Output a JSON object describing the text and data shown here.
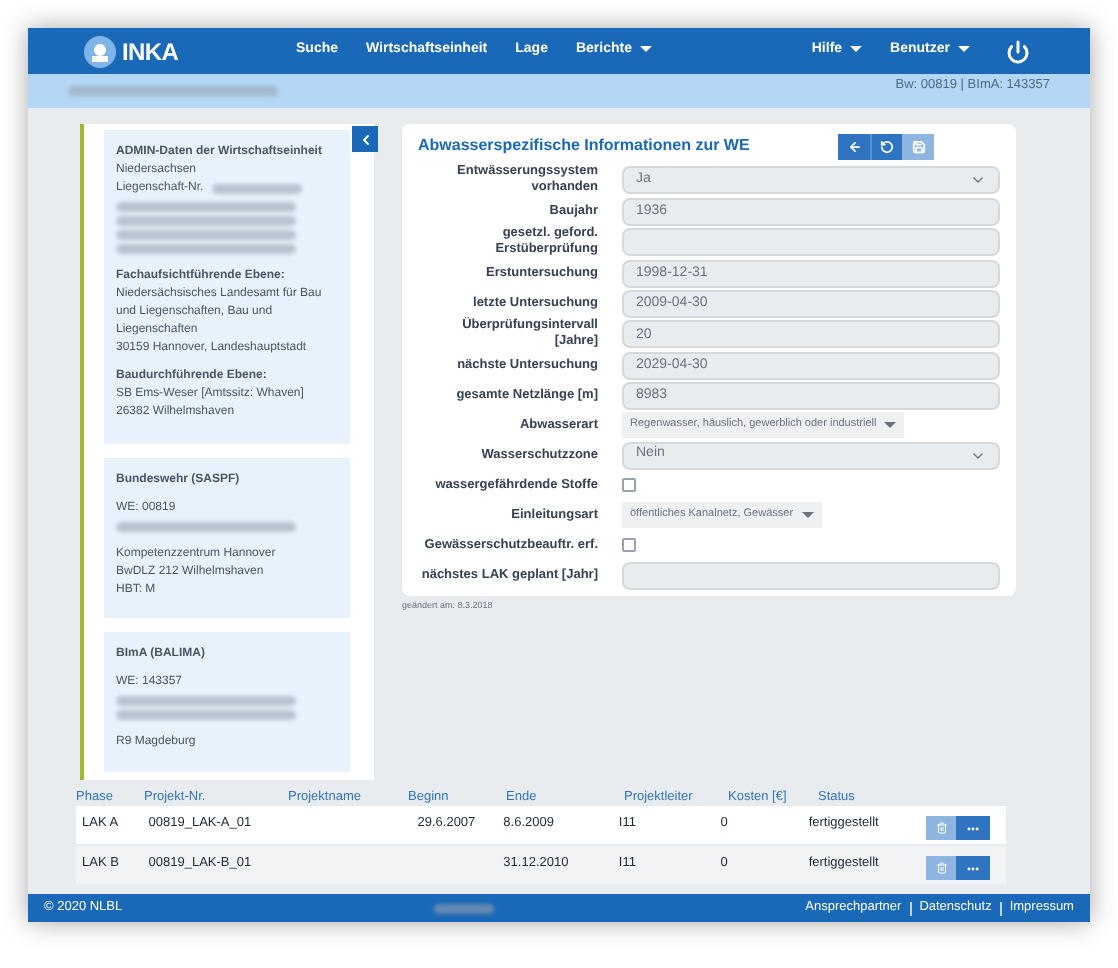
{
  "nav": {
    "brand": "INKA",
    "menu": [
      {
        "label": "Suche",
        "dropdown": false
      },
      {
        "label": "Wirtschaftseinheit",
        "dropdown": false
      },
      {
        "label": "Lage",
        "dropdown": false
      },
      {
        "label": "Berichte",
        "dropdown": true
      }
    ],
    "right_menu": [
      {
        "label": "Hilfe",
        "dropdown": true
      },
      {
        "label": "Benutzer",
        "dropdown": true
      }
    ]
  },
  "subbar": {
    "ids": "Bw: 00819 | BImA: 143357"
  },
  "info_cards": [
    {
      "lines": [
        {
          "kind": "heading",
          "text": "ADMIN-Daten der Wirtschaftseinheit"
        },
        {
          "kind": "text",
          "text": "Niedersachsen"
        },
        {
          "kind": "text",
          "text": "Liegenschaft-Nr.",
          "redacted": true
        },
        {
          "kind": "blurred"
        },
        {
          "kind": "blurred"
        },
        {
          "kind": "blurred"
        },
        {
          "kind": "blurred"
        },
        {
          "kind": "gap"
        },
        {
          "kind": "heading",
          "text": "Fachaufsichtführende Ebene:"
        },
        {
          "kind": "text",
          "text": "Niedersächsisches Landesamt für Bau und Liegenschaften, Bau und Liegenschaften"
        },
        {
          "kind": "text",
          "text": "30159 Hannover, Landeshauptstadt"
        },
        {
          "kind": "gap"
        },
        {
          "kind": "heading",
          "text": "Baudurchführende Ebene:"
        },
        {
          "kind": "text",
          "text": "SB Ems-Weser [Amtssitz: Whaven]"
        },
        {
          "kind": "text",
          "text": "26382 Wilhelmshaven"
        }
      ]
    },
    {
      "lines": [
        {
          "kind": "heading",
          "text": "Bundeswehr (SASPF)"
        },
        {
          "kind": "gap"
        },
        {
          "kind": "text",
          "text": "WE: 00819"
        },
        {
          "kind": "blurred"
        },
        {
          "kind": "gap"
        },
        {
          "kind": "text",
          "text": "Kompetenzzentrum Hannover"
        },
        {
          "kind": "text",
          "text": "BwDLZ 212 Wilhelmshaven"
        },
        {
          "kind": "text",
          "text": "HBT: M"
        }
      ]
    },
    {
      "lines": [
        {
          "kind": "heading",
          "text": "BImA (BALIMA)"
        },
        {
          "kind": "gap"
        },
        {
          "kind": "text",
          "text": "WE: 143357"
        },
        {
          "kind": "blurred"
        },
        {
          "kind": "blurred"
        },
        {
          "kind": "gap"
        },
        {
          "kind": "text",
          "text": "R9 Magdeburg"
        }
      ]
    }
  ],
  "form": {
    "title": "Abwasserspezifische Informationen zur WE",
    "save_disabled": true,
    "fields": [
      {
        "kind": "select",
        "label": "Entwässerungssystem vorhanden",
        "value": "Ja"
      },
      {
        "kind": "input",
        "label": "Baujahr",
        "value": "1936"
      },
      {
        "kind": "input",
        "label": "gesetzl. geford. Erstüberprüfung"
      },
      {
        "kind": "input",
        "label": "Erstuntersuchung",
        "value": "1998-12-31"
      },
      {
        "kind": "input",
        "label": "letzte Untersuchung",
        "value": "2009-04-30"
      },
      {
        "kind": "input",
        "label": "Überprüfungsintervall [Jahre]",
        "value": "20"
      },
      {
        "kind": "input",
        "label": "nächste Untersuchung",
        "value": "2029-04-30"
      },
      {
        "kind": "input",
        "label": "gesamte Netzlänge [m]",
        "value": "8983"
      },
      {
        "kind": "tags",
        "label": "Abwasserart",
        "value": "Regenwasser, häuslich, gewerblich oder industriell"
      },
      {
        "kind": "select",
        "label": "Wasserschutzzone",
        "value": "Nein"
      },
      {
        "kind": "checkbox",
        "label": "wassergefährdende Stoffe",
        "checked": false
      },
      {
        "kind": "tags",
        "label": "Einleitungsart",
        "value": "öffentliches Kanalnetz, Gewässer"
      },
      {
        "kind": "checkbox",
        "label": "Gewässerschutzbeauftr. erf.",
        "checked": false
      },
      {
        "kind": "input",
        "label": "nächstes LAK geplant [Jahr]"
      }
    ],
    "changed": "geändert am: 8.3.2018"
  },
  "table": {
    "columns": [
      "Phase",
      "Projekt-Nr.",
      "Projektname",
      "Beginn",
      "Ende",
      "Projektleiter",
      "Kosten [€]",
      "Status"
    ],
    "rows": [
      [
        "LAK A",
        "00819_LAK-A_01",
        "",
        "29.6.2007",
        "8.6.2009",
        "I11",
        "0",
        "fertiggestellt"
      ],
      [
        "LAK B",
        "00819_LAK-B_01",
        "",
        "",
        "31.12.2010",
        "I11",
        "0",
        "fertiggestellt"
      ]
    ]
  },
  "footer": {
    "copyright": "© 2020 NLBL",
    "links": [
      "Ansprechpartner",
      "Datenschutz",
      "Impressum"
    ]
  }
}
